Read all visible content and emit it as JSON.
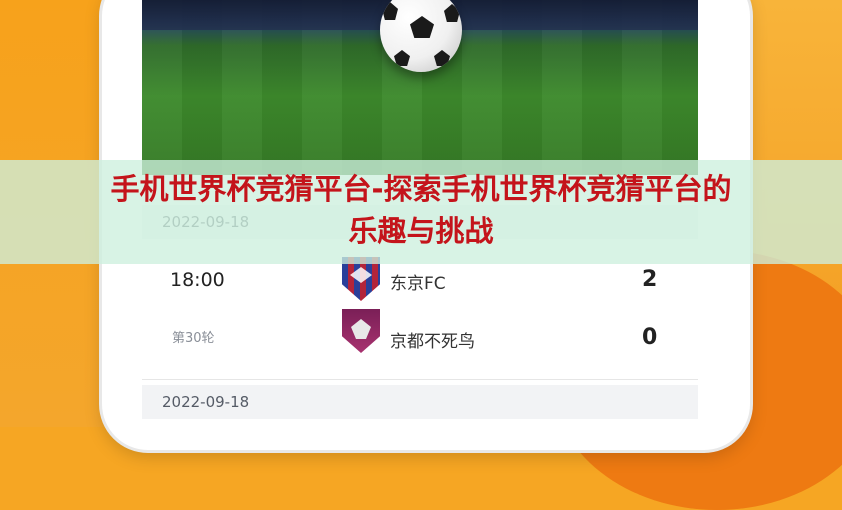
{
  "banner": {
    "line1": "手机世界杯竞猜平台-探索手机世界杯竞猜平台的",
    "line2": "乐趣与挑战"
  },
  "schedule": {
    "groups": [
      {
        "date": "2022-09-18",
        "match": {
          "time": "18:00",
          "round": "第30轮",
          "home_team": "东京FC",
          "home_score": "2",
          "away_team": "京都不死鸟",
          "away_score": "0"
        }
      },
      {
        "date": "2022-09-18"
      }
    ]
  },
  "icons": {
    "ball": "soccer-ball-icon",
    "home_crest": "fc-tokyo-crest-icon",
    "away_crest": "kyoto-sanga-crest-icon"
  },
  "colors": {
    "banner_text": "#c4141b",
    "background": "#f6a623"
  }
}
